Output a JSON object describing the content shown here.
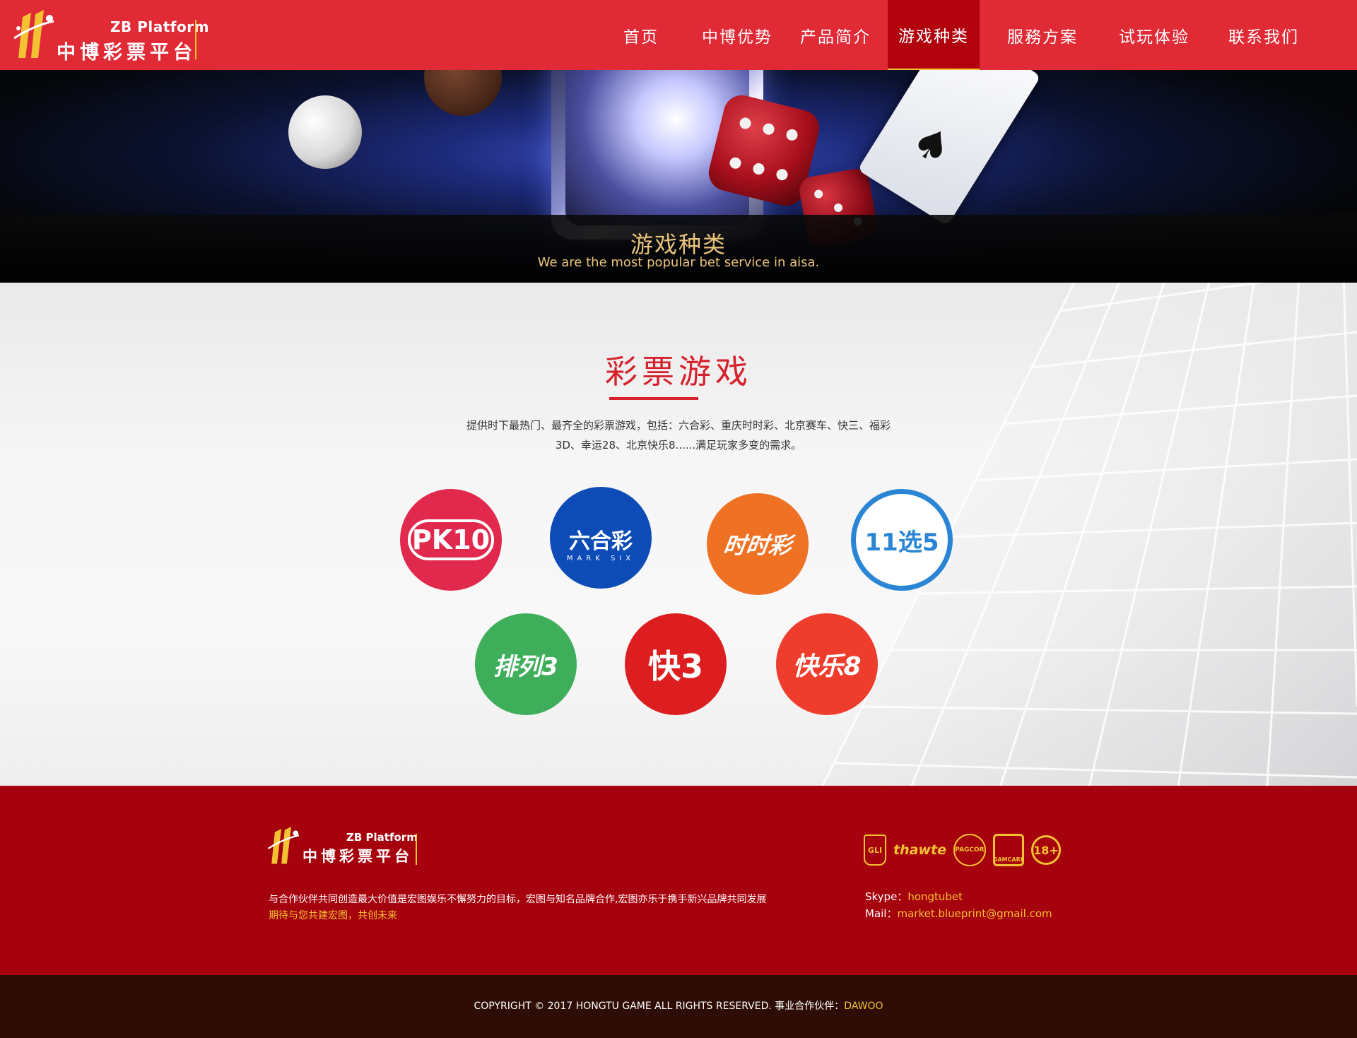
{
  "header": {
    "logo_en": "ZB Platform",
    "logo_cn": "中博彩票平台",
    "nav": [
      {
        "label": "首页",
        "active": false
      },
      {
        "label": "中博优势",
        "active": false
      },
      {
        "label": "产品简介",
        "active": false
      },
      {
        "label": "游戏种类",
        "active": true
      },
      {
        "label": "服務方案",
        "active": false
      },
      {
        "label": "试玩体验",
        "active": false
      },
      {
        "label": "联系我们",
        "active": false
      }
    ]
  },
  "banner": {
    "title": "游戏种类",
    "subtitle": "We are the most popular bet service in aisa."
  },
  "main": {
    "title": "彩票游戏",
    "description": "提供时下最热门、最齐全的彩票游戏，包括：六合彩、重庆时时彩、北京赛车、快三、福彩3D、幸运28、北京快乐8......满足玩家多变的需求。",
    "games": [
      {
        "text": "PK10",
        "icon": "pk10-icon",
        "color": "#e1284d"
      },
      {
        "text": "六合彩",
        "sub": "MARK SIX",
        "icon": "mark-six-icon",
        "color": "#0d4bb7"
      },
      {
        "text": "时时彩",
        "icon": "shishicai-icon",
        "color": "#ef7124"
      },
      {
        "text": "11选5",
        "icon": "11-choose-5-icon",
        "color": "#2a86d4"
      },
      {
        "text": "排列3",
        "icon": "pailie3-icon",
        "color": "#3fae5b"
      },
      {
        "text": "快3",
        "icon": "kuai3-icon",
        "color": "#dd1e20"
      },
      {
        "text": "快乐8",
        "icon": "kuaile8-icon",
        "color": "#ef3d2d"
      }
    ]
  },
  "footer": {
    "logo_en": "ZB Platform",
    "logo_cn": "中博彩票平台",
    "desc_line1": "与合作伙伴共同创造最大价值是宏图娱乐不懈努力的目标，宏图与知名品牌合作,宏图亦乐于携手新兴品牌共同发展",
    "desc_line2": "期待与您共建宏图，共创未来",
    "certs": {
      "gli": "GLI",
      "thawte": "thawte",
      "pagcor": "PAGCOR",
      "gamcare": "GAMCARE",
      "age": "18+"
    },
    "skype_label": "Skype：",
    "skype_value": "hongtubet",
    "mail_label": "Mail：",
    "mail_value": "market.blueprint@gmail.com"
  },
  "copyright": {
    "text": "COPYRIGHT © 2017 HONGTU GAME ALL RIGHTS RESERVED.   事业合作伙伴：",
    "partner": "DAWOO"
  },
  "colors": {
    "header_red": "#e02a35",
    "nav_active": "#b1020d",
    "footer_red": "#a6020d",
    "gold": "#f3c233",
    "title_red": "#d5222c",
    "copyright_bg": "#2d0d05"
  }
}
